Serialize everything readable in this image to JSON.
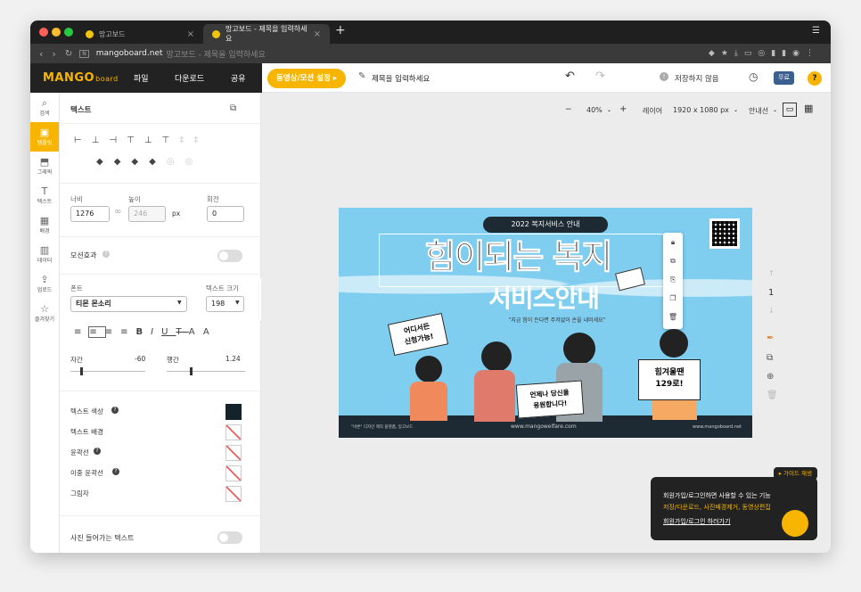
{
  "browser": {
    "tabs": [
      {
        "title": "망고보드"
      },
      {
        "title": "망고보드 - 제목을 입력하세요"
      }
    ],
    "new_tab": "+",
    "url_domain": "mangoboard.net",
    "url_rest": "망고보드 - 제목을 입력하세요"
  },
  "app": {
    "logo": "MANGO",
    "logo_small": "board",
    "menu": [
      "파일",
      "다운로드",
      "공유"
    ],
    "motion_button": "동영상/모션 설정 ▸",
    "title_placeholder": "제목을 입력하세요",
    "save_status": "저장하지 않음",
    "plan_badge": "무료",
    "help": "?"
  },
  "sidebar": {
    "items": [
      {
        "label": "검색",
        "icon": "search-icon",
        "glyph": "⌕"
      },
      {
        "label": "템플릿",
        "icon": "template-icon",
        "glyph": "▣"
      },
      {
        "label": "그래픽",
        "icon": "graphic-icon",
        "glyph": "⬒"
      },
      {
        "label": "텍스트",
        "icon": "text-icon",
        "glyph": "T"
      },
      {
        "label": "배경",
        "icon": "background-icon",
        "glyph": "▦"
      },
      {
        "label": "데이터",
        "icon": "chart-icon",
        "glyph": "▥"
      },
      {
        "label": "업로드",
        "icon": "upload-icon",
        "glyph": "⇪"
      },
      {
        "label": "즐겨찾기",
        "icon": "star-icon",
        "glyph": "☆"
      }
    ]
  },
  "panel": {
    "title": "텍스트",
    "width_label": "너비",
    "width_value": "1276",
    "height_label": "높이",
    "height_value": "246",
    "unit": "px",
    "rotate_label": "회전",
    "rotate_value": "0",
    "motion_label": "모션효과",
    "font_label": "폰트",
    "font_value": "티몬 몬소리",
    "size_label": "텍스트 크기",
    "size_value": "198",
    "letter_spacing_label": "자간",
    "letter_spacing_value": "-60",
    "line_height_label": "행간",
    "line_height_value": "1.24",
    "text_color_label": "텍스트 색상",
    "text_color": "#13222b",
    "text_bg_label": "텍스트 배경",
    "outline_label": "윤곽선",
    "double_outline_label": "이중 윤곽선",
    "shadow_label": "그림자",
    "photo_text_label": "사진 들어가는 텍스트"
  },
  "toolbar": {
    "zoom": "40%",
    "layer": "레이어",
    "size": "1920 x 1080 px",
    "guide": "안내선"
  },
  "design": {
    "badge": "2022 복지서비스 안내",
    "title1": "힘이되는 복지",
    "title2": "서비스안내",
    "subtitle": "\"지금 힘이 든다면 주저없이 손을 내미세요\"",
    "sign1_l1": "어디서든",
    "sign1_l2": "신청가능!",
    "sign2_l1": "언제나 당신을",
    "sign2_l2": "응원합니다!",
    "sign3_l1": "힘겨울땐",
    "sign3_l2": "129로!",
    "footer_left": "\"바른\" 디자인 제작 플랫폼, 망고보드",
    "footer_center": "www.mangowelfare.com",
    "footer_right": "www.mangoboard.net"
  },
  "page_number": "1",
  "tooltip": {
    "badge": "▸ 가이드 재생",
    "line1": "회원가입/로그인하면 사용할 수 있는 기능",
    "line2": "저장/다운로드, 사진배경제거, 동영상편집",
    "link": "회원가입/로그인 하러가기"
  }
}
